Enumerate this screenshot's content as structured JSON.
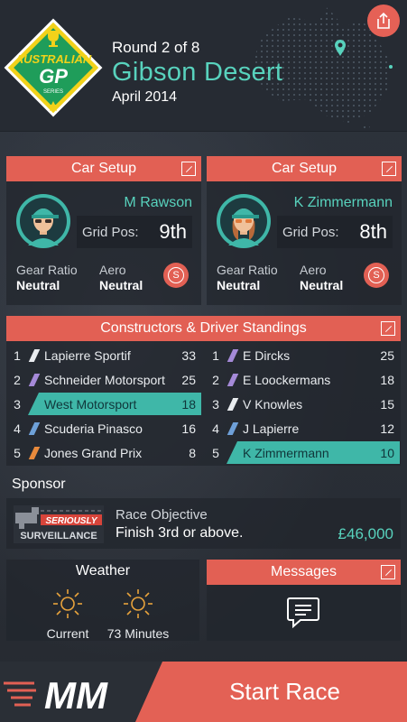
{
  "header": {
    "logo_text_top": "AUSTRALIAN",
    "logo_text_gp": "GP",
    "logo_text_series": "SERIES",
    "round": "Round 2 of 8",
    "location": "Gibson Desert",
    "date": "April 2014",
    "share_icon": "share-icon"
  },
  "car_setup": [
    {
      "title": "Car Setup",
      "driver": "M Rawson",
      "grid_label": "Grid Pos:",
      "grid_pos": "9th",
      "gear_label": "Gear Ratio",
      "gear_value": "Neutral",
      "aero_label": "Aero",
      "aero_value": "Neutral",
      "setup_button": "S"
    },
    {
      "title": "Car Setup",
      "driver": "K Zimmermann",
      "grid_label": "Grid Pos:",
      "grid_pos": "8th",
      "gear_label": "Gear Ratio",
      "gear_value": "Neutral",
      "aero_label": "Aero",
      "aero_value": "Neutral",
      "setup_button": "S"
    }
  ],
  "standings": {
    "title": "Constructors & Driver Standings",
    "constructors": [
      {
        "pos": "1",
        "name": "Lapierre Sportif",
        "points": "33",
        "color": "#e9ecef"
      },
      {
        "pos": "2",
        "name": "Schneider Motorsport",
        "points": "25",
        "color": "#a58ad8"
      },
      {
        "pos": "3",
        "name": "West Motorsport",
        "points": "18",
        "color": "#3fb7a8",
        "highlight": true
      },
      {
        "pos": "4",
        "name": "Scuderia Pinasco",
        "points": "16",
        "color": "#6ea0d8"
      },
      {
        "pos": "5",
        "name": "Jones Grand Prix",
        "points": "8",
        "color": "#e88a3c"
      }
    ],
    "drivers": [
      {
        "pos": "1",
        "name": "E Dircks",
        "points": "25",
        "color": "#a58ad8"
      },
      {
        "pos": "2",
        "name": "E Loockermans",
        "points": "18",
        "color": "#a58ad8"
      },
      {
        "pos": "3",
        "name": "V Knowles",
        "points": "15",
        "color": "#e9ecef"
      },
      {
        "pos": "4",
        "name": "J Lapierre",
        "points": "12",
        "color": "#6ea0d8"
      },
      {
        "pos": "5",
        "name": "K Zimmermann",
        "points": "10",
        "color": "#3fb7a8",
        "highlight": true
      }
    ]
  },
  "sponsor": {
    "title": "Sponsor",
    "logo_line1": "SERIOUSLY",
    "logo_line2": "SURVEILLANCE",
    "objective_label": "Race Objective",
    "objective_value": "Finish 3rd or above.",
    "reward": "£46,000"
  },
  "weather": {
    "title": "Weather",
    "items": [
      {
        "label": "Current",
        "icon": "sun-icon"
      },
      {
        "label": "73 Minutes",
        "icon": "sun-icon"
      }
    ]
  },
  "messages": {
    "title": "Messages",
    "icon": "speech-bubble-icon"
  },
  "footer": {
    "start_label": "Start Race",
    "logo_text": "MM"
  },
  "colors": {
    "accent": "#e26054",
    "teal": "#58d2bd",
    "highlight": "#3fb7a8"
  }
}
